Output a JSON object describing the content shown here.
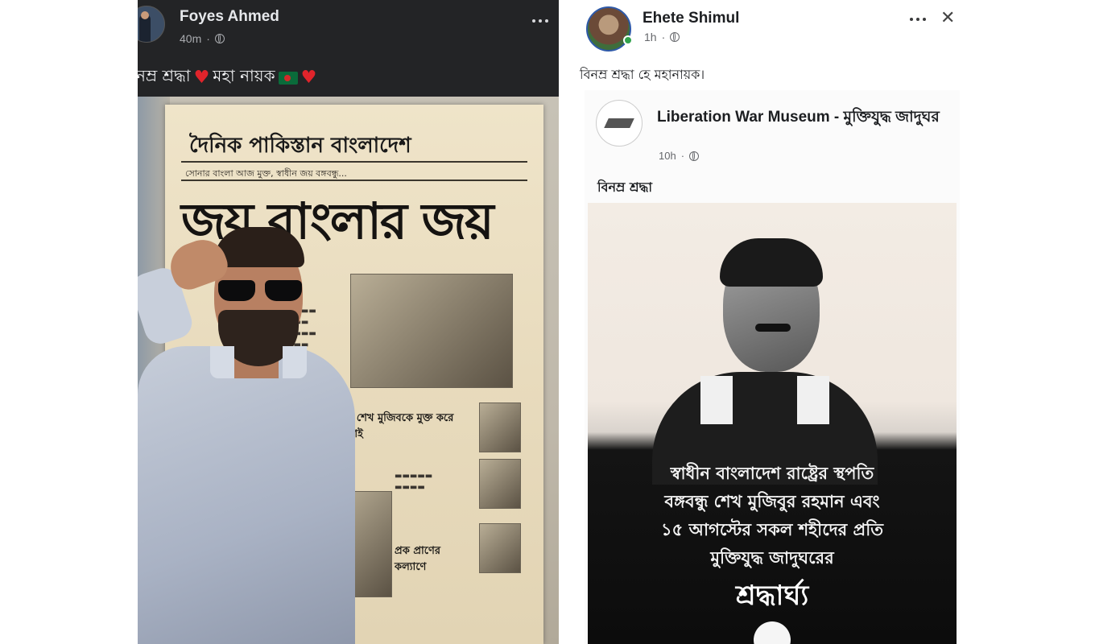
{
  "left_post": {
    "author": "Foyes Ahmed",
    "time": "40m",
    "caption_part1": "নম্র শ্রদ্ধা",
    "caption_part2": "মহা নায়ক",
    "heart_glyph": "♥",
    "newspaper": {
      "masthead": "দৈনিক পাকিস্তান বাংলাদেশ",
      "subline": "সোনার বাংলা আজ মুক্ত, স্বাধীন জয় বঙ্গবন্ধু...",
      "headline": "জয় বাংলার জয়",
      "story1": "বঙ্গবন্ধু শেখ মুজিবকে মুক্ত করে আনবোই",
      "story2": "প্রক প্রাণের কল্যাণে"
    }
  },
  "right_post": {
    "author": "Ehete Shimul",
    "time": "1h",
    "caption": "বিনম্র শ্রদ্ধা হে মহানায়ক।",
    "close_glyph": "✕",
    "shared": {
      "page_name": "Liberation War Museum - মুক্তিযুদ্ধ জাদুঘর",
      "time": "10h",
      "caption": "বিনম্র শ্রদ্ধা",
      "tribute_lines": [
        "স্বাধীন বাংলাদেশ রাষ্ট্রের স্থপতি",
        "বঙ্গবন্ধু শেখ মুজিবুর রহমান এবং",
        "১৫ আগস্টের সকল শহীদের প্রতি",
        "মুক্তিযুদ্ধ জাদুঘরের"
      ],
      "tribute_title": "শ্রদ্ধার্ঘ্য"
    }
  },
  "colors": {
    "dark_bg": "#1b1c1e",
    "heart": "#e0242b",
    "online": "#31a24c"
  }
}
